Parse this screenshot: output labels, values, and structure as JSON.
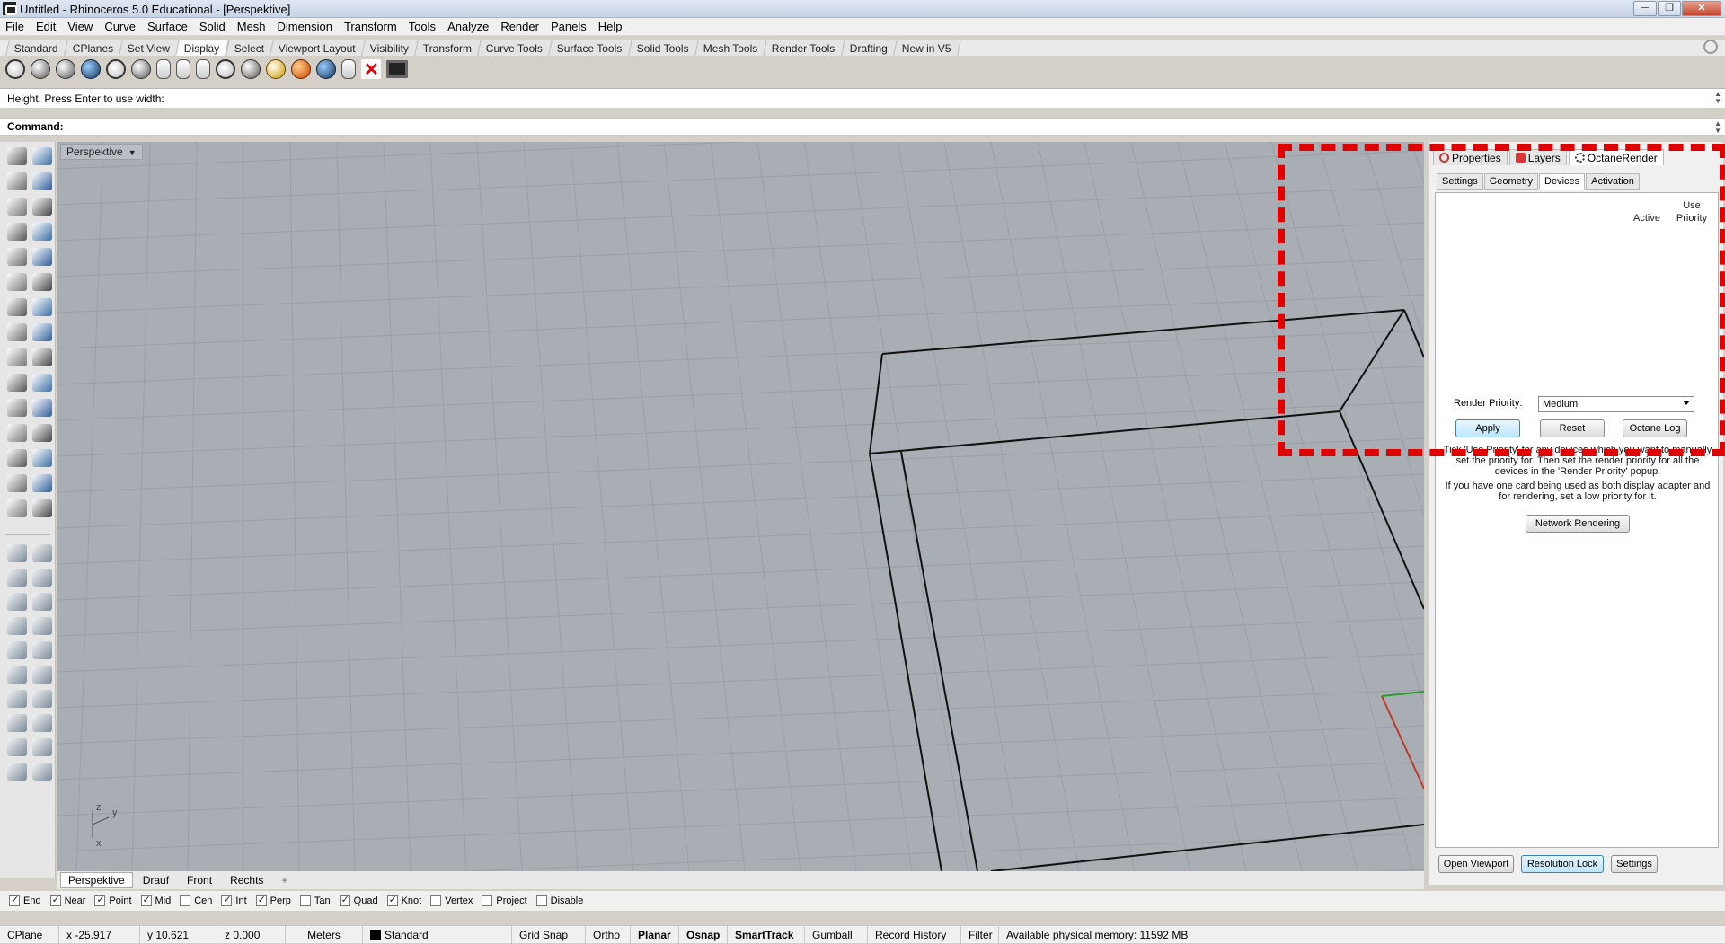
{
  "window": {
    "title": "Untitled - Rhinoceros 5.0 Educational - [Perspektive]",
    "min": "─",
    "max": "❐",
    "close": "✕"
  },
  "menu": [
    "File",
    "Edit",
    "View",
    "Curve",
    "Surface",
    "Solid",
    "Mesh",
    "Dimension",
    "Transform",
    "Tools",
    "Analyze",
    "Render",
    "Panels",
    "Help"
  ],
  "toolbar_tabs": [
    "Standard",
    "CPlanes",
    "Set View",
    "Display",
    "Select",
    "Viewport Layout",
    "Visibility",
    "Transform",
    "Curve Tools",
    "Surface Tools",
    "Solid Tools",
    "Mesh Tools",
    "Render Tools",
    "Drafting",
    "New in V5"
  ],
  "active_toolbar_tab": "Display",
  "command": {
    "history": "Height. Press Enter to use width:",
    "prompt_label": "Command:"
  },
  "viewport": {
    "title": "Perspektive",
    "axis_labels": {
      "z": "z",
      "y": "y",
      "x": "x"
    }
  },
  "view_tabs": [
    "Perspektive",
    "Drauf",
    "Front",
    "Rechts",
    "+"
  ],
  "panel": {
    "tabs": [
      "Properties",
      "Layers",
      "OctaneRender"
    ],
    "subtabs": [
      "Settings",
      "Geometry",
      "Devices",
      "Activation"
    ],
    "active_subtab": "Devices",
    "col_active": "Active",
    "col_use": "Use",
    "col_priority": "Priority",
    "render_priority_label": "Render Priority:",
    "render_priority_value": "Medium",
    "apply": "Apply",
    "reset": "Reset",
    "octane_log": "Octane Log",
    "help1": "Tick 'Use Priority' for any devices which you want to manually set the priority for. Then set the render priority for all the devices in the 'Render Priority' popup.",
    "help2": "If you have one card being used as both display adapter and for rendering, set a low priority for it.",
    "network_rendering": "Network Rendering",
    "open_viewport": "Open Viewport",
    "resolution_lock": "Resolution Lock",
    "settings": "Settings"
  },
  "osnaps": [
    {
      "label": "End",
      "checked": true
    },
    {
      "label": "Near",
      "checked": true
    },
    {
      "label": "Point",
      "checked": true
    },
    {
      "label": "Mid",
      "checked": true
    },
    {
      "label": "Cen",
      "checked": false
    },
    {
      "label": "Int",
      "checked": true
    },
    {
      "label": "Perp",
      "checked": true
    },
    {
      "label": "Tan",
      "checked": false
    },
    {
      "label": "Quad",
      "checked": true
    },
    {
      "label": "Knot",
      "checked": true
    },
    {
      "label": "Vertex",
      "checked": false
    },
    {
      "label": "Project",
      "checked": false
    },
    {
      "label": "Disable",
      "checked": false
    }
  ],
  "status": {
    "cplane": "CPlane",
    "x": "x -25.917",
    "y": "y 10.621",
    "z": "z 0.000",
    "units": "Meters",
    "layer": "Standard",
    "grid_snap": "Grid Snap",
    "ortho": "Ortho",
    "planar": "Planar",
    "osnap": "Osnap",
    "smarttrack": "SmartTrack",
    "gumball": "Gumball",
    "record_history": "Record History",
    "filter": "Filter",
    "memory": "Available physical memory: 11592 MB"
  },
  "colors": {
    "viewport_bg": "#a8aeb4",
    "grid_minor": "#9aa0a6",
    "highlight": "#e00000"
  }
}
